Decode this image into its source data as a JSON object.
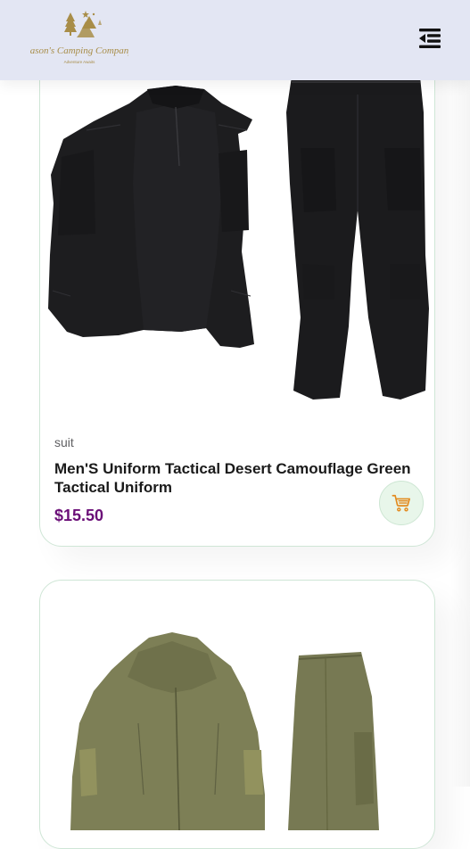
{
  "header": {
    "logo_name": "Jason's Camping Company",
    "logo_tagline": "Adventure Awaits",
    "menu_icon": "menu-collapse-icon"
  },
  "products": [
    {
      "brand": "suit",
      "name": "Men'S Uniform Tactical Desert Camouflage Green Tactical Uniform",
      "price": "$15.50",
      "image_icon": "black-tactical-uniform-image",
      "cart_icon": "shopping-cart-icon"
    },
    {
      "image_icon": "olive-tactical-uniform-image"
    }
  ],
  "colors": {
    "header_bg": "#e3e6f3",
    "price": "#6b0f78",
    "cart_button_bg": "#e8f6ea",
    "cart_icon": "#e38a1e",
    "logo_gold": "#a88d48",
    "card_border": "#cfe6d6"
  }
}
